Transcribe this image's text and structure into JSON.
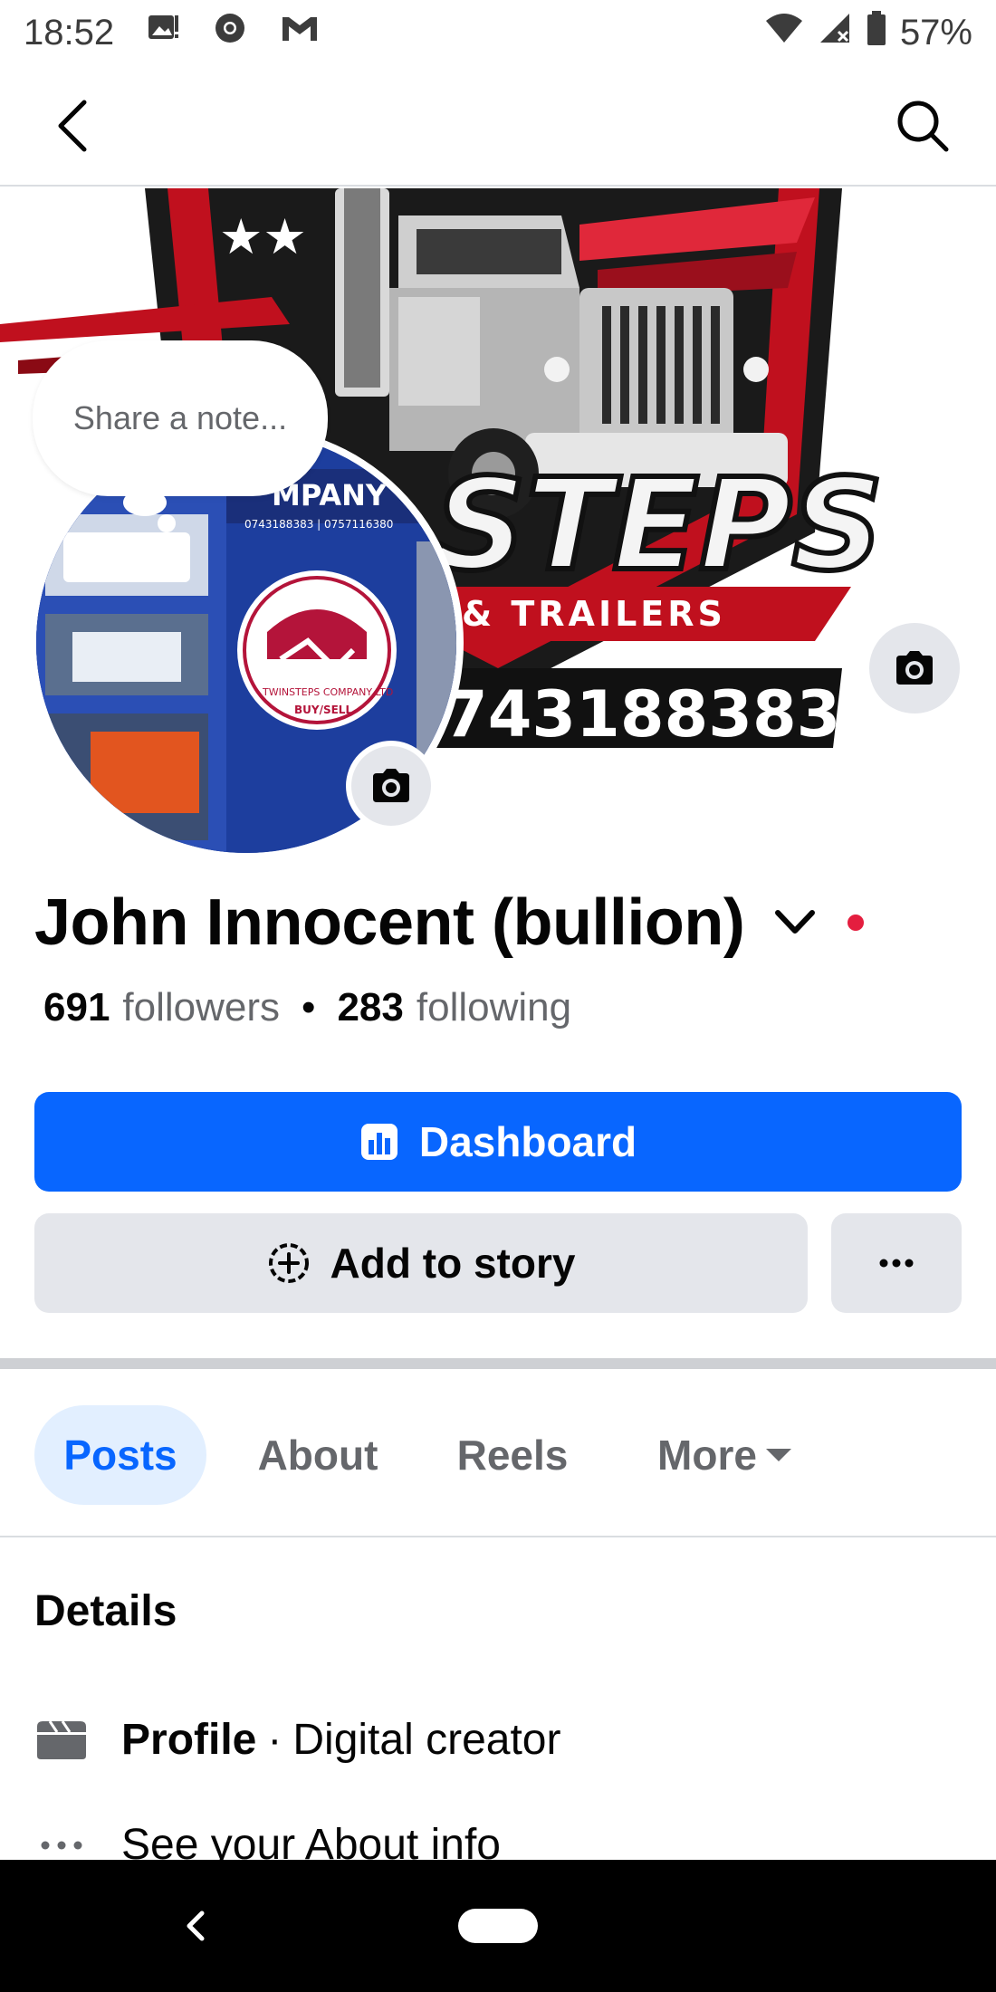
{
  "status_bar": {
    "time": "18:52",
    "battery": "57%",
    "icons": [
      "gallery-notification-icon",
      "chrome-icon",
      "gmail-icon",
      "wifi-icon",
      "signal-icon",
      "battery-icon"
    ]
  },
  "nav": {
    "back_icon": "chevron-left-icon",
    "search_icon": "search-icon"
  },
  "cover": {
    "brand_text": "STEPS",
    "sub_text": "& TRAILERS",
    "phone_text": "743188383",
    "stars": "★★",
    "camera_icon": "camera-icon"
  },
  "avatar": {
    "sign_text": "MPANY",
    "sign_numbers": "0743188383 | 0757116380",
    "logo_text": "TWINSTEPS COMPANY LTD",
    "logo_sub": "BUY/SELL",
    "camera_icon": "camera-icon"
  },
  "note": {
    "placeholder": "Share a note..."
  },
  "profile": {
    "name": "John Innocent (bullion)",
    "followers_count": "691",
    "followers_label": "followers",
    "separator": "•",
    "following_count": "283",
    "following_label": "following"
  },
  "actions": {
    "dashboard_label": "Dashboard",
    "add_story_label": "Add to story",
    "more_label": "···"
  },
  "tabs": [
    {
      "label": "Posts",
      "active": true
    },
    {
      "label": "About",
      "active": false
    },
    {
      "label": "Reels",
      "active": false
    },
    {
      "label": "More",
      "active": false
    }
  ],
  "details": {
    "title": "Details",
    "profile_label": "Profile",
    "profile_separator": "·",
    "profile_value": "Digital creator",
    "about_link": "See your About info"
  },
  "colors": {
    "accent": "#0866ff",
    "button_gray": "#e4e6eb",
    "active_tab_bg": "#e2efff",
    "live_dot": "#e41e3f",
    "cover_red": "#c0101e"
  }
}
